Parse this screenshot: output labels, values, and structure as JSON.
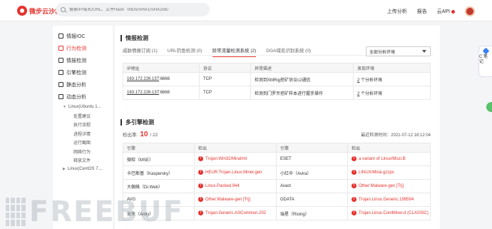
{
  "header": {
    "logo_text": "微步云沙箱",
    "search_placeholder": "搜索IP/域名/URL、文件Hash（MD5/SHA1/SHA256）",
    "nav": {
      "upload": "上传分析",
      "report": "报告",
      "cloud_api": "云API"
    },
    "colors": {
      "brand": "#e5322d"
    }
  },
  "sidebar": {
    "items": [
      {
        "label": "情报IOC",
        "icon": "list-icon",
        "active": false
      },
      {
        "label": "行为检测",
        "icon": "behavior-icon",
        "active": true
      },
      {
        "label": "情报检测",
        "icon": "intel-icon",
        "active": false
      },
      {
        "label": "引擎检测",
        "icon": "engine-icon",
        "active": false
      },
      {
        "label": "静态分析",
        "icon": "static-icon",
        "active": false
      },
      {
        "label": "动态分析",
        "icon": "dynamic-icon",
        "active": false
      }
    ],
    "env1": "Linux(Ubuntu 1...",
    "env1_children": [
      "处置建议",
      "执行流程",
      "进程详情",
      "运行截图",
      "网络行为",
      "释放文件"
    ],
    "env2": "Linux(CentOS 7...."
  },
  "intel": {
    "title": "情报检测",
    "tabs": [
      {
        "label": "威胁情报订阅 (1)",
        "active": false
      },
      {
        "label": "URL钓鱼检测 (0)",
        "active": false
      },
      {
        "label": "异常流量检测系统 (2)",
        "active": true
      },
      {
        "label": "DGA域名识别系统 (0)",
        "active": false
      }
    ],
    "env_select": "全部分析环境",
    "columns": [
      "IP地址",
      "协议",
      "异常描述",
      "发现环境"
    ],
    "rows": [
      {
        "ip": "163.172.226.137",
        "port": ":6666",
        "proto": "TCP",
        "desc": "检测到XMRig挖矿协议c2通信",
        "env_count": "2",
        "env_text": " 个分析环境"
      },
      {
        "ip": "163.172.226.137",
        "port": ":6666",
        "proto": "TCP",
        "desc": "检测到门罗币挖矿样本进行握手操作",
        "env_count": "2",
        "env_text": " 个分析环境"
      }
    ]
  },
  "engines": {
    "title": "多引擎检测",
    "rate_label": "检出率:",
    "rate_detected": "10",
    "rate_total": "/ 22",
    "last_time": "最近检测时间：2021-07-12 18:12:04",
    "columns": [
      "引擎",
      "检出",
      "引擎",
      "检出"
    ],
    "rows": [
      {
        "e1": "微软（MSE）",
        "d1": "Trojan:Win32/Mirai!ml",
        "e2": "ESET",
        "d2": "a variant of Linux/Mozi.B"
      },
      {
        "e1": "卡巴斯基（Kaspersky）",
        "d1": "HEUR:Trojan.Linux.Miner.gen",
        "e2": "小红伞（Avira）",
        "d2": "LINUX/Mirai.gzzps"
      },
      {
        "e1": "大蜘蛛（Dr.Web）",
        "d1": "Linux.Packed.944",
        "e2": "Avast",
        "d2": "Other:Malware-gen [Trj]"
      },
      {
        "e1": "AVG",
        "d1": "Other:Malware-gen [Trj]",
        "e2": "GDATA",
        "d2": "Trojan.Linux.Generic.199594"
      },
      {
        "e1": "安天（Antiy）",
        "d1": "Trojan.Generic.ASCommon.202",
        "e2": "瑞星（Rising）",
        "d2": "Trojan.Linux.CoinMiner.d (CLASSIC)"
      }
    ]
  },
  "float_tab": {
    "label": "C 笔 记"
  },
  "watermark": "FREEBUF"
}
